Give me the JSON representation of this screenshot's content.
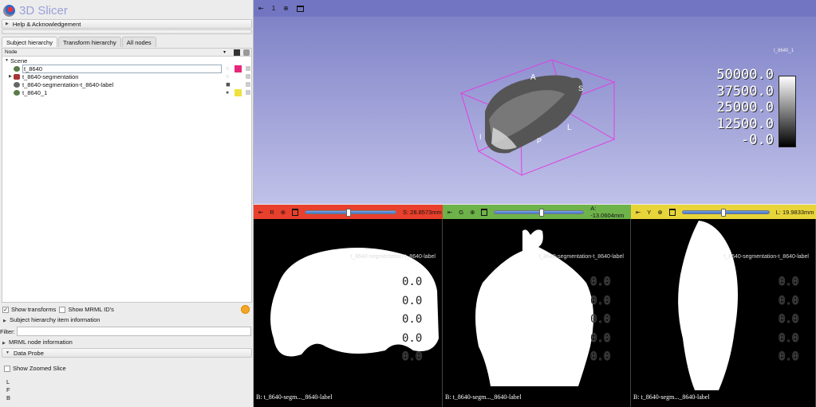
{
  "app": {
    "title": "3D Slicer"
  },
  "panel": {
    "help": "Help & Acknowledgement",
    "tabs": [
      "Subject hierarchy",
      "Transform hierarchy",
      "All nodes"
    ],
    "tree_header": "Node",
    "scene": "Scene",
    "items": [
      {
        "name": "t_8640",
        "color": "#e8277a"
      },
      {
        "name": "t_8640-segmentation",
        "color": ""
      },
      {
        "name": "t_8640-segmentation-t_8640-label",
        "color": ""
      },
      {
        "name": "t_8640_1",
        "color": "#f0e040"
      }
    ],
    "show_transforms": "Show transforms",
    "show_mrml_ids": "Show MRML ID's",
    "item_info": "Subject hierarchy item information",
    "filter_label": "Filter:",
    "filter_value": "",
    "mrml_info": "MRML node information",
    "data_probe": "Data Probe",
    "show_zoomed": "Show Zoomed Slice",
    "probe": [
      "L",
      "F",
      "B"
    ]
  },
  "view3d": {
    "label": "1",
    "volume_name": "t_8640_1",
    "scalar_bar": [
      "50000.0",
      "37500.0",
      "25000.0",
      "12500.0",
      "-0.0"
    ],
    "axes": [
      "A",
      "S",
      "L",
      "I",
      "P"
    ]
  },
  "slices": [
    {
      "name": "R",
      "color": "#e8402c",
      "offset": "S: 28.8573mm",
      "slider": 0.45
    },
    {
      "name": "G",
      "color": "#6eb24a",
      "offset": "A: -13.0604mm",
      "slider": 0.5
    },
    {
      "name": "Y",
      "color": "#e8d53a",
      "offset": "L: 19.9833mm",
      "slider": 0.45
    }
  ],
  "slice_overlay": {
    "label": "t_8640-segmentation-t_8640-label",
    "value": "0.0",
    "bottom": "B: t_8640-segm..._8640-label"
  }
}
